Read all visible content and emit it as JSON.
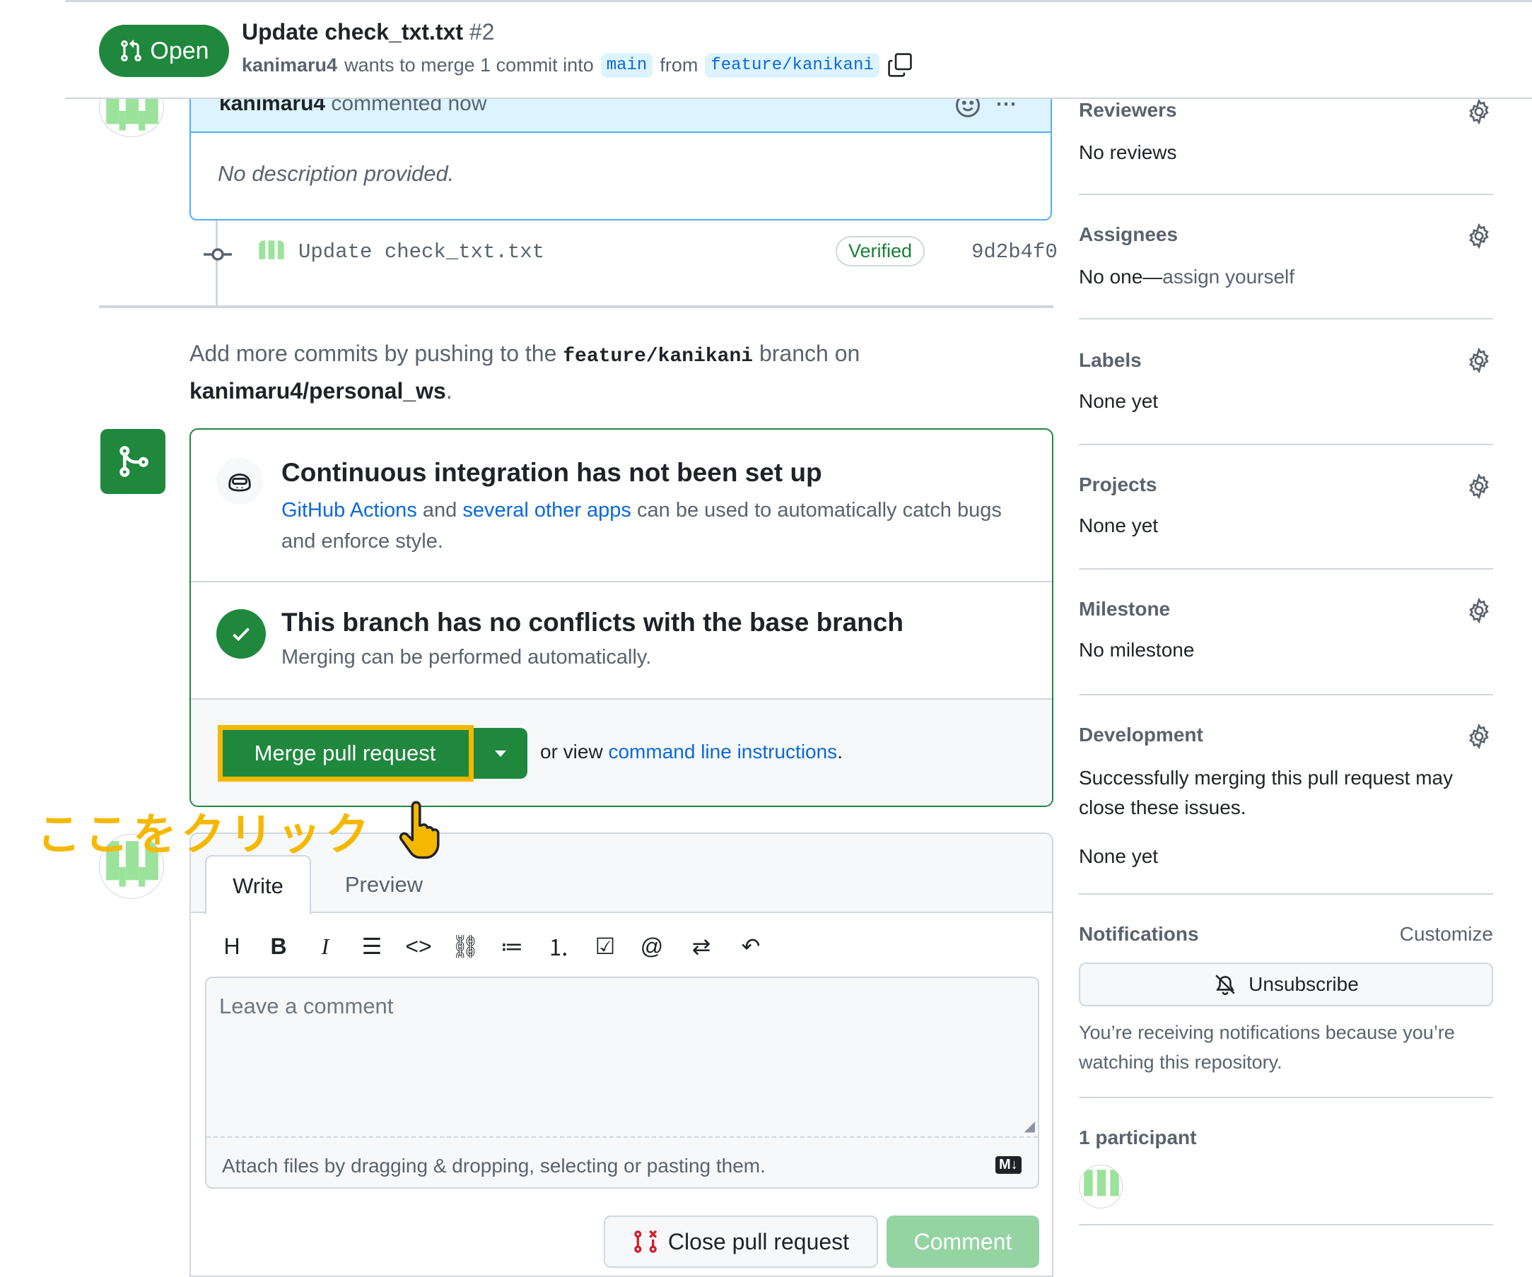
{
  "header": {
    "state_label": "Open",
    "title": "Update check_txt.txt",
    "number": "#2",
    "author": "kanimaru4",
    "merge_text": "wants to merge 1 commit into",
    "base_branch": "main",
    "from_text": "from",
    "head_branch": "feature/kanikani"
  },
  "comment": {
    "author": "kanimaru4",
    "action": "commented now",
    "body": "No description provided."
  },
  "commit": {
    "message": "Update check_txt.txt",
    "badge": "Verified",
    "sha": "9d2b4f0"
  },
  "push_hint": {
    "prefix": "Add more commits by pushing to the",
    "branch": "feature/kanikani",
    "middle": "branch on",
    "repo": "kanimaru4/personal_ws",
    "suffix": "."
  },
  "merge_box": {
    "ci_title": "Continuous integration has not been set up",
    "ci_link1": "GitHub Actions",
    "ci_and": "and",
    "ci_link2": "several other apps",
    "ci_rest_line1": "can be used to automatically catch bugs",
    "ci_rest_line2": "and enforce style.",
    "conflict_title": "This branch has no conflicts with the base branch",
    "conflict_sub": "Merging can be performed automatically.",
    "merge_button": "Merge pull request",
    "or_view": "or view",
    "cli_link": "command line instructions",
    "cli_suffix": "."
  },
  "annotation": {
    "text": "ここをクリック"
  },
  "editor": {
    "tab_write": "Write",
    "tab_preview": "Preview",
    "placeholder": "Leave a comment",
    "attach_hint": "Attach files by dragging & dropping, selecting or pasting them.",
    "md_badge": "M↓",
    "close_button": "Close pull request",
    "comment_button": "Comment"
  },
  "sidebar": {
    "reviewers": {
      "title": "Reviewers",
      "value": "No reviews"
    },
    "assignees": {
      "title": "Assignees",
      "value_prefix": "No one—",
      "value_link": "assign yourself"
    },
    "labels": {
      "title": "Labels",
      "value": "None yet"
    },
    "projects": {
      "title": "Projects",
      "value": "None yet"
    },
    "milestone": {
      "title": "Milestone",
      "value": "No milestone"
    },
    "development": {
      "title": "Development",
      "desc_line1": "Successfully merging this pull request may",
      "desc_line2": "close these issues.",
      "value": "None yet"
    },
    "notifications": {
      "title": "Notifications",
      "customize": "Customize",
      "unsubscribe": "Unsubscribe",
      "reason_line1": "You’re receiving notifications because you’re",
      "reason_line2": "watching this repository."
    },
    "participants": {
      "title": "1 participant"
    }
  },
  "colors": {
    "green": "#1f883d",
    "link": "#0969da",
    "highlight": "#f5b800",
    "annotation": "#f5b800"
  }
}
